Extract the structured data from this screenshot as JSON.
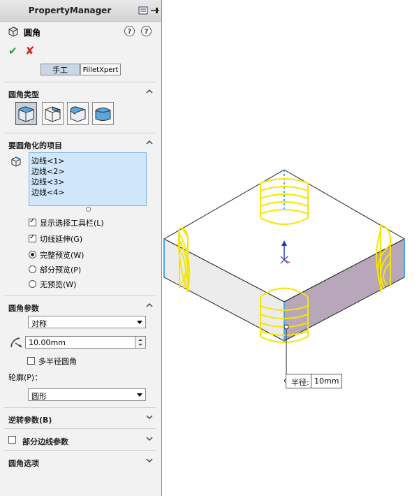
{
  "panel": {
    "title": "PropertyManager",
    "feature_title": "圆角",
    "help_icons": [
      "?",
      "?"
    ]
  },
  "tabs": [
    {
      "label": "手工",
      "active": true
    },
    {
      "label": "FilletXpert",
      "active": false
    }
  ],
  "sections": {
    "fillet_type": {
      "label": "圆角类型",
      "selected_index": 0
    },
    "items": {
      "label": "要圆角化的项目",
      "list": [
        "边线<1>",
        "边线<2>",
        "边线<3>",
        "边线<4>"
      ],
      "show_toolbar": {
        "label": "显示选择工具栏(L)",
        "checked": true
      },
      "tangent": {
        "label": "切线延伸(G)",
        "checked": true
      },
      "preview_options": [
        {
          "label": "完整预览(W)",
          "selected": true
        },
        {
          "label": "部分预览(P)",
          "selected": false
        },
        {
          "label": "无预览(W)",
          "selected": false
        }
      ]
    },
    "params": {
      "label": "圆角参数",
      "method": "对称",
      "radius": "10.00mm",
      "multi_radius": {
        "label": "多半径圆角",
        "checked": false
      },
      "profile_label": "轮廓(P)：",
      "profile": "圆形"
    },
    "setback": {
      "label": "逆转参数(B)"
    },
    "partial_edge": {
      "label": "部分边线参数",
      "checked": false
    },
    "options": {
      "label": "圆角选项"
    }
  },
  "callout": {
    "label": "半径:",
    "value": "10mm"
  },
  "colors": {
    "accent": "#4da3e8",
    "preview": "#f5e600",
    "face_right": "#b8a6bb"
  }
}
